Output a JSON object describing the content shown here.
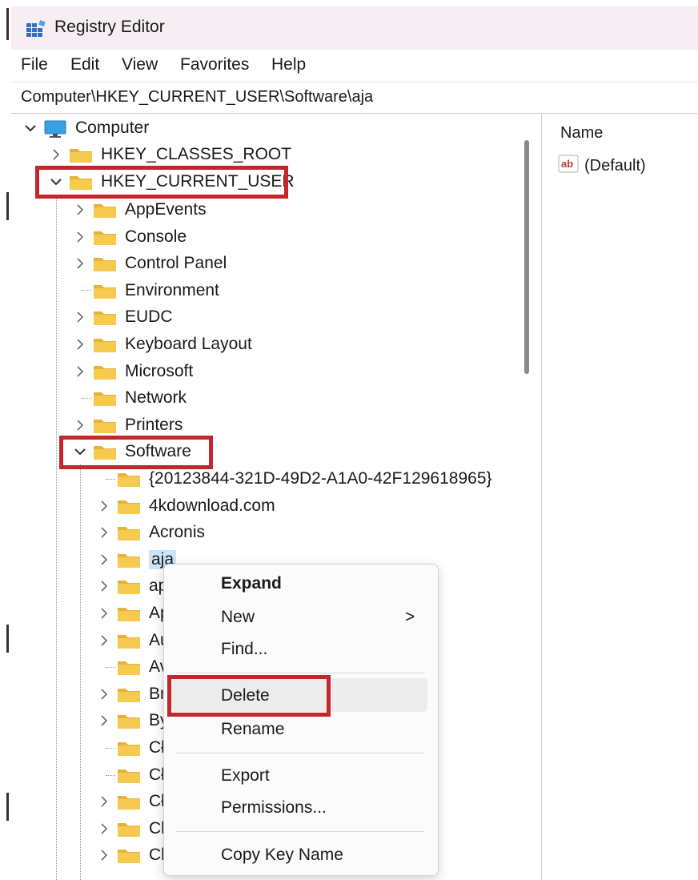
{
  "window": {
    "title": "Registry Editor"
  },
  "menu": [
    "File",
    "Edit",
    "View",
    "Favorites",
    "Help"
  ],
  "address": "Computer\\HKEY_CURRENT_USER\\Software\\aja",
  "tree": {
    "root": "Computer",
    "hives": [
      "HKEY_CLASSES_ROOT",
      "HKEY_CURRENT_USER"
    ],
    "hkcu_children": [
      "AppEvents",
      "Console",
      "Control Panel",
      "Environment",
      "EUDC",
      "Keyboard Layout",
      "Microsoft",
      "Network",
      "Printers",
      "Software"
    ],
    "software_children": [
      "{20123844-321D-49D2-A1A0-42F129618965}",
      "4kdownload.com",
      "Acronis",
      "aja",
      "ap",
      "Ap",
      "Au",
      "Av",
      "Br",
      "By",
      "Cł",
      "Cł",
      "Cł",
      "Cl",
      "Cl"
    ]
  },
  "context_menu": {
    "items": [
      "Expand",
      "New",
      "Find...",
      "Delete",
      "Rename",
      "Export",
      "Permissions...",
      "Copy Key Name"
    ],
    "submenu_arrow": ">"
  },
  "right_pane": {
    "column_name": "Name",
    "default_value": "(Default)",
    "value_icon_text": "ab"
  },
  "colors": {
    "highlight_box": "#c4262e",
    "folder": "#f3c24e",
    "selection": "#cce4f7"
  },
  "icons": {
    "app": "registry-editor-icon",
    "computer": "monitor-icon",
    "folder": "folder-icon",
    "value": "string-value-icon"
  }
}
